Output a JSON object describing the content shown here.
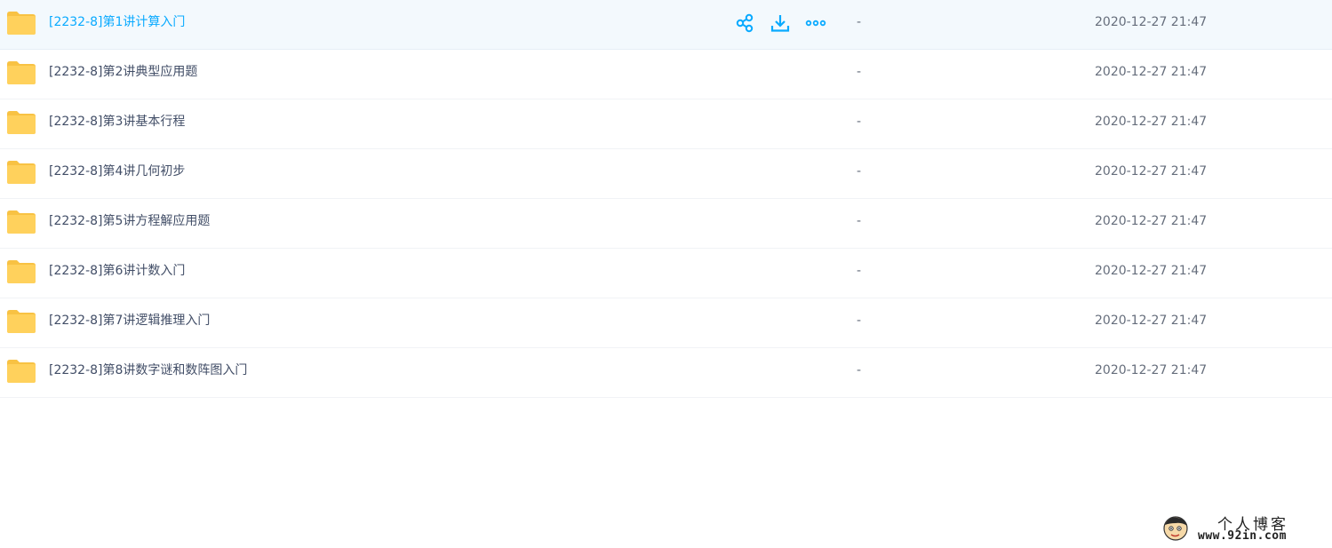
{
  "colors": {
    "accent": "#09aaff",
    "folder": "#ffd15c",
    "folder_tab": "#f8c243",
    "hover_row": "#f3f9fd",
    "text": "#424e67",
    "muted_text": "#666e7c"
  },
  "actions": {
    "share_icon": "share-icon",
    "download_icon": "download-icon",
    "more_icon": "more-icon"
  },
  "files": [
    {
      "name": "[2232-8]第1讲计算入门",
      "size": "-",
      "modified": "2020-12-27 21:47",
      "hovered": true
    },
    {
      "name": "[2232-8]第2讲典型应用题",
      "size": "-",
      "modified": "2020-12-27 21:47",
      "hovered": false
    },
    {
      "name": "[2232-8]第3讲基本行程",
      "size": "-",
      "modified": "2020-12-27 21:47",
      "hovered": false
    },
    {
      "name": "[2232-8]第4讲几何初步",
      "size": "-",
      "modified": "2020-12-27 21:47",
      "hovered": false
    },
    {
      "name": "[2232-8]第5讲方程解应用题",
      "size": "-",
      "modified": "2020-12-27 21:47",
      "hovered": false
    },
    {
      "name": "[2232-8]第6讲计数入门",
      "size": "-",
      "modified": "2020-12-27 21:47",
      "hovered": false
    },
    {
      "name": "[2232-8]第7讲逻辑推理入门",
      "size": "-",
      "modified": "2020-12-27 21:47",
      "hovered": false
    },
    {
      "name": "[2232-8]第8讲数字谜和数阵图入门",
      "size": "-",
      "modified": "2020-12-27 21:47",
      "hovered": false
    }
  ],
  "watermark": {
    "title": "个人博客",
    "url": "www.92in.com"
  }
}
